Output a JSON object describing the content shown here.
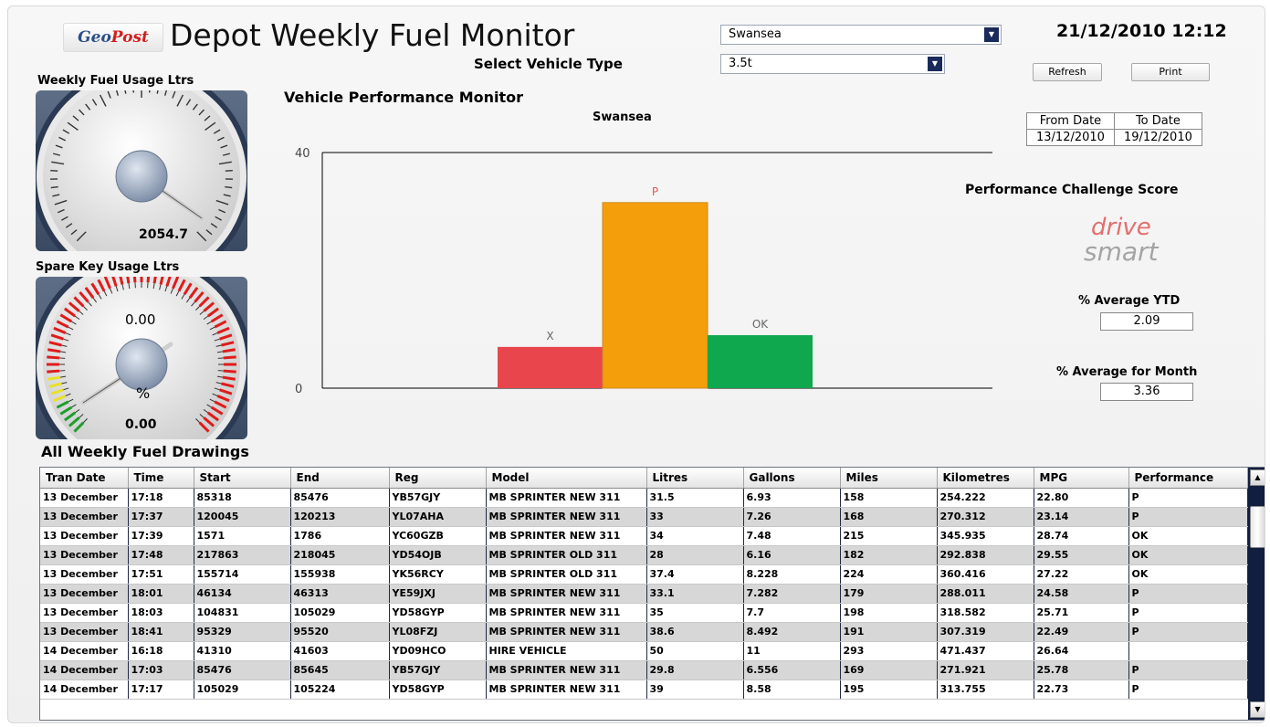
{
  "header": {
    "logo_geo": "Geo",
    "logo_post": "Post",
    "title": "Depot Weekly Fuel Monitor",
    "depot_selected": "Swansea",
    "vehicle_type_label": "Select Vehicle Type",
    "vehicle_type_selected": "3.5t",
    "datetime": "21/12/2010 12:12",
    "refresh_label": "Refresh",
    "print_label": "Print"
  },
  "gauges": {
    "weekly_label": "Weekly Fuel Usage Ltrs",
    "weekly_value": "2054.7",
    "spare_label": "Spare Key Usage Ltrs",
    "spare_top_value": "0.00",
    "spare_unit": "%",
    "spare_bottom_value": "0.00"
  },
  "dates": {
    "from_label": "From Date",
    "to_label": "To Date",
    "from_value": "13/12/2010",
    "to_value": "19/12/2010"
  },
  "score": {
    "title": "Performance Challenge Score",
    "logo_top": "drive",
    "logo_bottom": "smart",
    "ytd_label": "% Average YTD",
    "ytd_value": "2.09",
    "month_label": "% Average for Month",
    "month_value": "3.36"
  },
  "chart_data": {
    "type": "bar",
    "title": "Vehicle Performance Monitor",
    "subtitle": "Swansea",
    "categories": [
      "X",
      "P",
      "OK"
    ],
    "values": [
      7,
      31.5,
      9
    ],
    "colors": [
      "#e8464c",
      "#f59e0b",
      "#10a84e"
    ],
    "ylim": [
      0,
      40
    ],
    "yticks": [
      "40",
      "0"
    ],
    "legend": [
      "X",
      "P",
      "OK"
    ],
    "legend_position": "bottom"
  },
  "table": {
    "title": "All Weekly Fuel Drawings",
    "columns": [
      "Tran Date",
      "Time",
      "Start",
      "End",
      "Reg",
      "Model",
      "Litres",
      "Gallons",
      "Miles",
      "Kilometres",
      "MPG",
      "Performance"
    ],
    "rows": [
      [
        "13 December",
        "17:18",
        "85318",
        "85476",
        "YB57GJY",
        "MB SPRINTER NEW 311",
        "31.5",
        "6.93",
        "158",
        "254.222",
        "22.80",
        "P"
      ],
      [
        "13 December",
        "17:37",
        "120045",
        "120213",
        "YL07AHA",
        "MB SPRINTER NEW 311",
        "33",
        "7.26",
        "168",
        "270.312",
        "23.14",
        "P"
      ],
      [
        "13 December",
        "17:39",
        "1571",
        "1786",
        "YC60GZB",
        "MB SPRINTER NEW 311",
        "34",
        "7.48",
        "215",
        "345.935",
        "28.74",
        "OK"
      ],
      [
        "13 December",
        "17:48",
        "217863",
        "218045",
        "YD54OJB",
        "MB SPRINTER OLD 311",
        "28",
        "6.16",
        "182",
        "292.838",
        "29.55",
        "OK"
      ],
      [
        "13 December",
        "17:51",
        "155714",
        "155938",
        "YK56RCY",
        "MB SPRINTER OLD 311",
        "37.4",
        "8.228",
        "224",
        "360.416",
        "27.22",
        "OK"
      ],
      [
        "13 December",
        "18:01",
        "46134",
        "46313",
        "YE59JXJ",
        "MB SPRINTER NEW 311",
        "33.1",
        "7.282",
        "179",
        "288.011",
        "24.58",
        "P"
      ],
      [
        "13 December",
        "18:03",
        "104831",
        "105029",
        "YD58GYP",
        "MB SPRINTER NEW 311",
        "35",
        "7.7",
        "198",
        "318.582",
        "25.71",
        "P"
      ],
      [
        "13 December",
        "18:41",
        "95329",
        "95520",
        "YL08FZJ",
        "MB SPRINTER NEW 311",
        "38.6",
        "8.492",
        "191",
        "307.319",
        "22.49",
        "P"
      ],
      [
        "14 December",
        "16:18",
        "41310",
        "41603",
        "YD09HCO",
        "HIRE VEHICLE",
        "50",
        "11",
        "293",
        "471.437",
        "26.64",
        ""
      ],
      [
        "14 December",
        "17:03",
        "85476",
        "85645",
        "YB57GJY",
        "MB SPRINTER NEW 311",
        "29.8",
        "6.556",
        "169",
        "271.921",
        "25.78",
        "P"
      ],
      [
        "14 December",
        "17:17",
        "105029",
        "105224",
        "YD58GYP",
        "MB SPRINTER NEW 311",
        "39",
        "8.58",
        "195",
        "313.755",
        "22.73",
        "P"
      ]
    ]
  }
}
